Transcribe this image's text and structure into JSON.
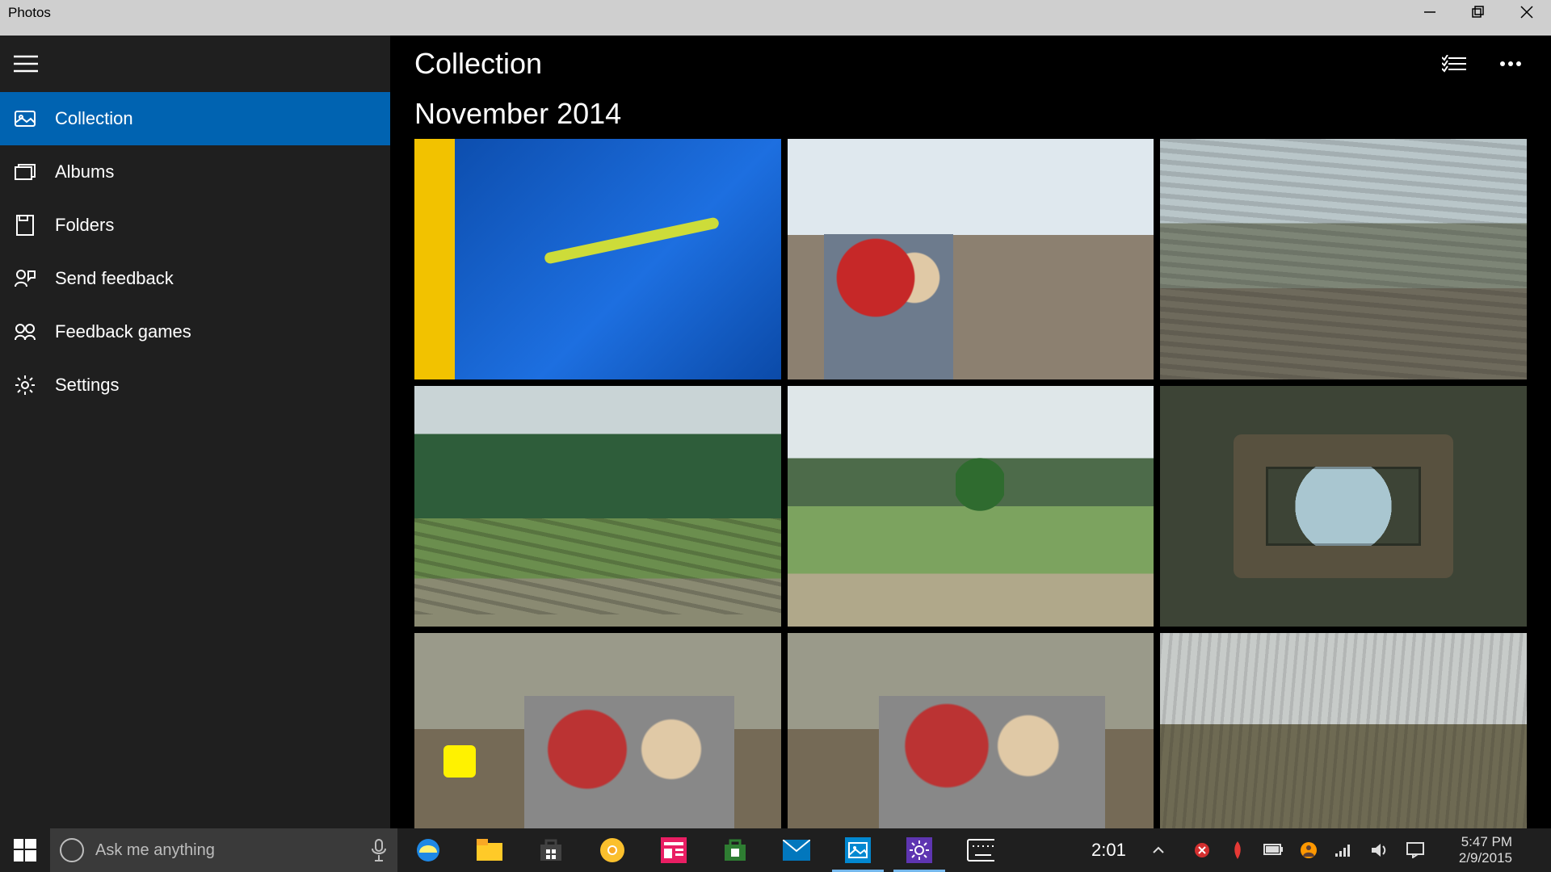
{
  "window": {
    "title": "Photos"
  },
  "sidebar": {
    "items": [
      {
        "label": "Collection",
        "icon": "collection-icon",
        "active": true
      },
      {
        "label": "Albums",
        "icon": "albums-icon"
      },
      {
        "label": "Folders",
        "icon": "folders-icon"
      },
      {
        "label": "Send feedback",
        "icon": "feedback-icon"
      },
      {
        "label": "Feedback games",
        "icon": "feedback-games-icon"
      },
      {
        "label": "Settings",
        "icon": "settings-icon"
      }
    ]
  },
  "content": {
    "header_title": "Collection",
    "date_heading": "November 2014"
  },
  "taskbar": {
    "search_placeholder": "Ask me anything",
    "timer": "2:01",
    "clock": {
      "time": "5:47 PM",
      "date": "2/9/2015"
    }
  }
}
